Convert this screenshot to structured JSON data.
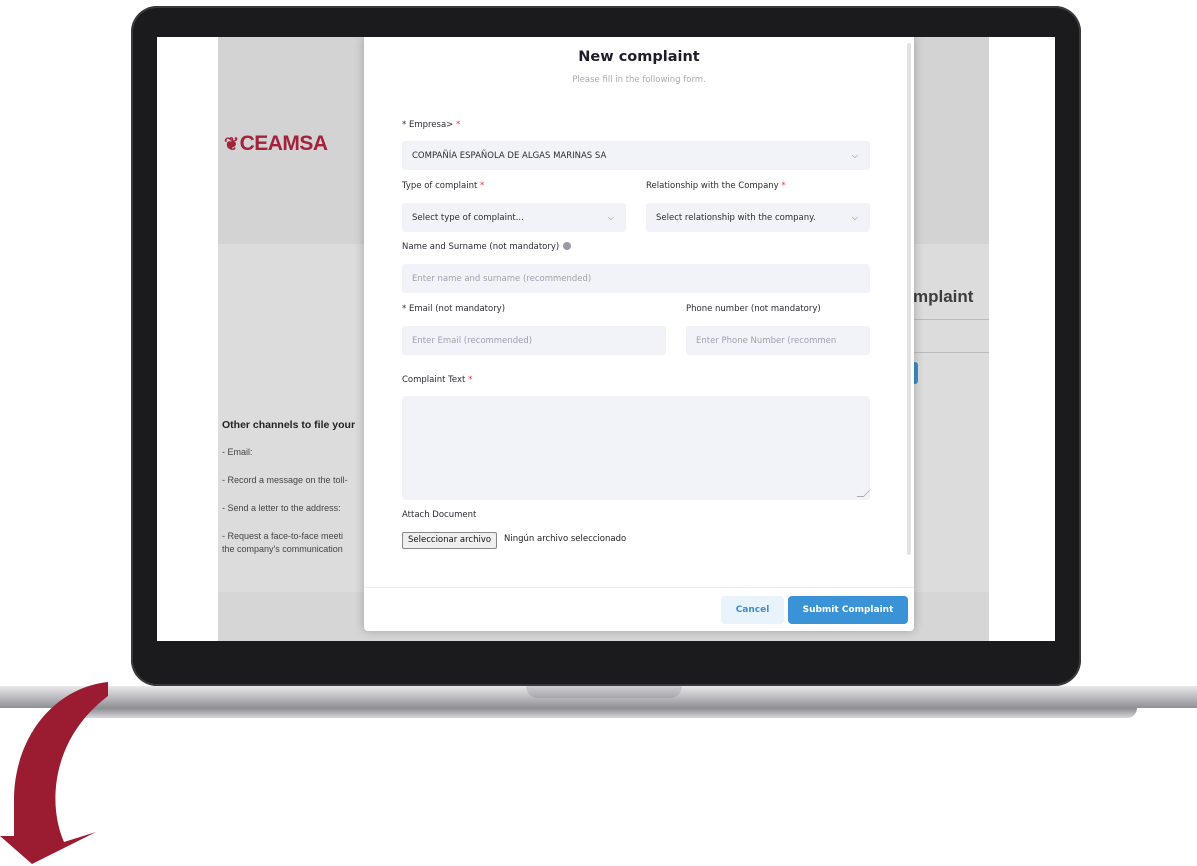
{
  "brand_colors": {
    "logo": "#a3233a",
    "accent": "#3a93d6",
    "required": "#e03b3b",
    "arrow": "#9b1b30"
  },
  "site": {
    "logo_text": "CEAMSA",
    "logo_icon": "leaf-emblem-icon",
    "heading_fragment": "mplaint",
    "channels": {
      "title": "Other channels to file your",
      "items": [
        "- Email:",
        "- Record a message on the toll-",
        "- Send a letter to the address:",
        "- Request a face-to-face meeti",
        "the company's communication"
      ]
    }
  },
  "modal": {
    "title": "New complaint",
    "subtitle": "Please fill in the following form.",
    "empresa": {
      "label": "* Empresa>",
      "required_mark": "*",
      "value": "COMPAÑÍA ESPAÑOLA DE ALGAS MARINAS SA"
    },
    "complaint_type": {
      "label": "Type of complaint",
      "required_mark": "*",
      "placeholder": "Select type of complaint..."
    },
    "relationship": {
      "label": "Relationship with the Company",
      "required_mark": "*",
      "placeholder": "Select relationship with the company."
    },
    "name": {
      "label": "Name and Surname (not mandatory)",
      "placeholder": "Enter name and surname (recommended)"
    },
    "email": {
      "label": "* Email (not mandatory)",
      "placeholder": "Enter Email (recommended)"
    },
    "phone": {
      "label": "Phone number (not mandatory)",
      "placeholder": "Enter Phone Number (recommen"
    },
    "complaint_text": {
      "label": "Complaint Text",
      "required_mark": "*"
    },
    "attach": {
      "label": "Attach Document",
      "button": "Seleccionar archivo",
      "status": "Ningún archivo seleccionado"
    },
    "cancel_label": "Cancel",
    "submit_label": "Submit Complaint"
  }
}
